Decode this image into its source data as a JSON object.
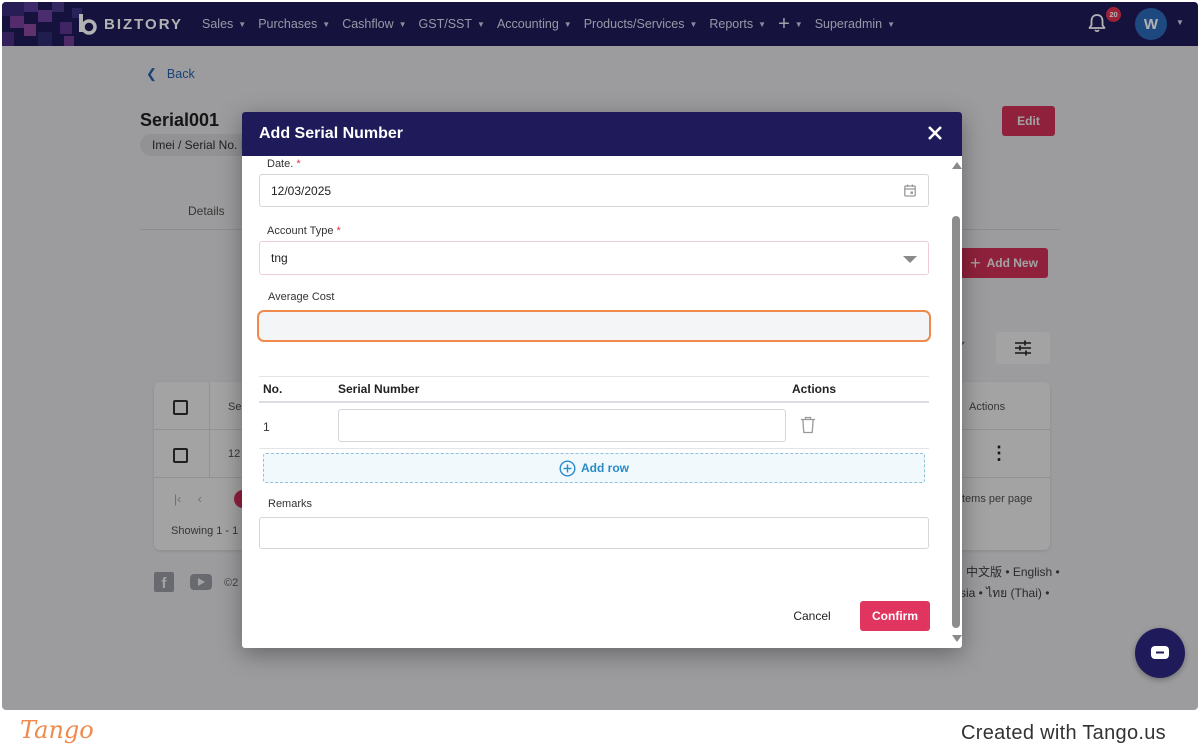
{
  "nav": {
    "brand": "BIZTORY",
    "menu": [
      {
        "label": "Sales"
      },
      {
        "label": "Purchases"
      },
      {
        "label": "Cashflow"
      },
      {
        "label": "GST/SST"
      },
      {
        "label": "Accounting"
      },
      {
        "label": "Products/Services"
      },
      {
        "label": "Reports"
      },
      {
        "label": "+"
      },
      {
        "label": "Superadmin"
      }
    ],
    "notification_count": "20",
    "avatar_initial": "W",
    "colors": {
      "nav_bg": "#1f1b5a",
      "accent": "#e0355f",
      "badge": "#e0324f"
    }
  },
  "page": {
    "back_label": "Back",
    "title": "Serial001",
    "chip_label": "Imei / Serial No. I",
    "edit_label": "Edit",
    "tab_details": "Details",
    "add_new_label": "Add New",
    "table": {
      "header_partial": "Se",
      "actions_header": "Actions",
      "row_partial": "12",
      "items_per_page_partial": "tems per page",
      "showing_partial": "Showing 1 - 1 c"
    },
    "footer": {
      "copyright_partial": "©2",
      "languages_line1": "中文版 • English •",
      "languages_line2": "sia • ไทย (Thai) •"
    }
  },
  "modal": {
    "title": "Add Serial Number",
    "date_label": "Date.",
    "required_mark": "*",
    "date_value": "12/03/2025",
    "account_type_label": "Account Type",
    "account_type_value": "tng",
    "average_cost_label": "Average Cost",
    "average_cost_value": "",
    "table": {
      "col_no": "No.",
      "col_serial": "Serial Number",
      "col_actions": "Actions",
      "rows": [
        {
          "no": "1",
          "serial": ""
        }
      ]
    },
    "add_row_label": "Add row",
    "remarks_label": "Remarks",
    "remarks_value": "",
    "cancel_label": "Cancel",
    "confirm_label": "Confirm"
  },
  "tango": {
    "logo": "Tango",
    "created_with": "Created with Tango.us"
  }
}
